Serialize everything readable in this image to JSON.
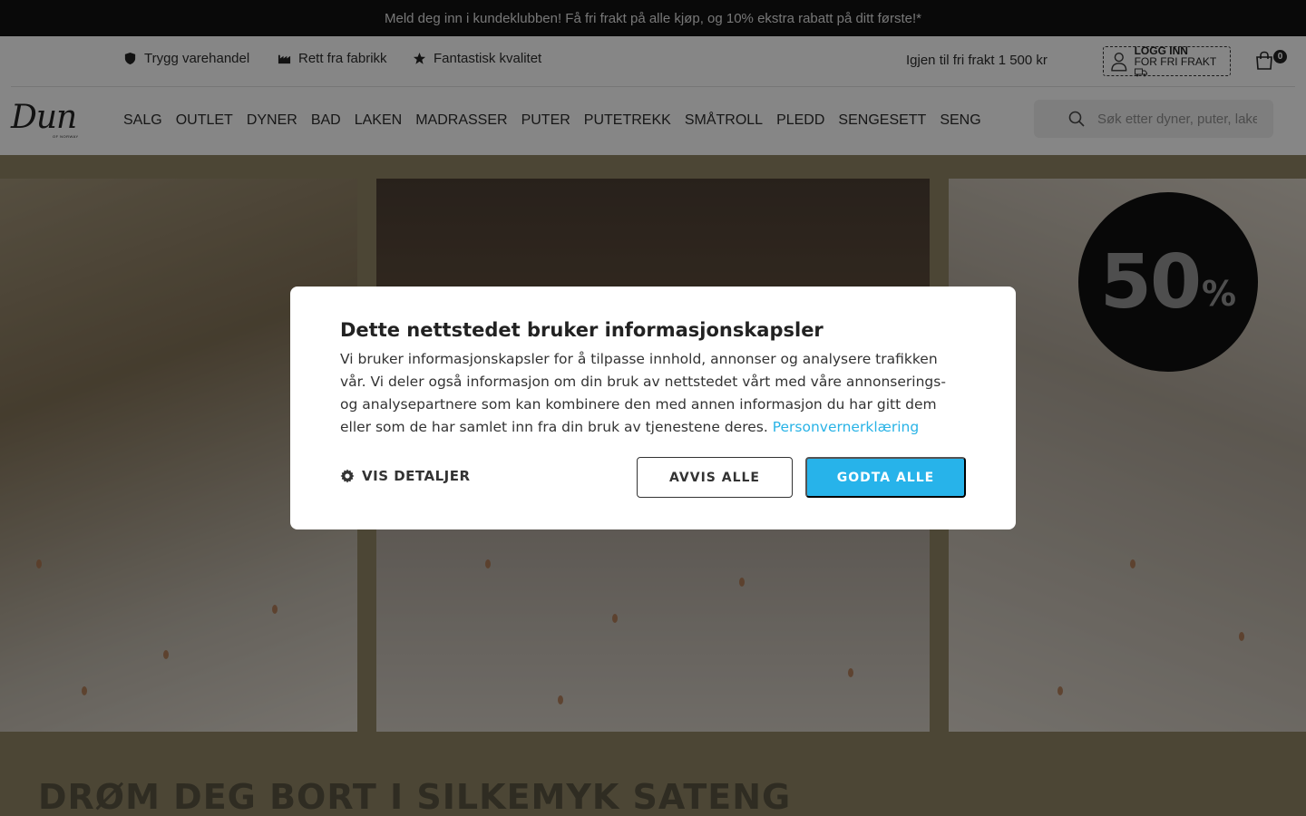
{
  "promo": {
    "text": "Meld deg inn i kundeklubben! Få fri frakt på alle kjøp, og 10% ekstra rabatt på ditt første!*"
  },
  "usps": [
    {
      "label": "Trygg varehandel",
      "icon": "shield-icon"
    },
    {
      "label": "Rett fra fabrikk",
      "icon": "factory-icon"
    },
    {
      "label": "Fantastisk kvalitet",
      "icon": "star-icon"
    }
  ],
  "shipping": {
    "text": "Igjen til fri frakt 1 500 kr"
  },
  "account": {
    "line1": "LOGG INN",
    "line2": "FOR FRI FRAKT"
  },
  "cart": {
    "count": "0"
  },
  "logo": {
    "main": "Dun",
    "sub": "OF NORWAY"
  },
  "nav": [
    "SALG",
    "OUTLET",
    "DYNER",
    "BAD",
    "LAKEN",
    "MADRASSER",
    "PUTER",
    "PUTETREKK",
    "SMÅTROLL",
    "PLEDD",
    "SENGESETT",
    "SENG"
  ],
  "search": {
    "placeholder": "Søk etter dyner, puter, laken"
  },
  "hero": {
    "badge_number": "50",
    "badge_percent": "%",
    "title": "DRØM DEG BORT I SILKEMYK SATENG"
  },
  "cookie_dialog": {
    "title": "Dette nettstedet bruker informasjonskapsler",
    "body": "Vi bruker informasjonskapsler for å tilpasse innhold, annonser og analysere trafikken vår. Vi deler også informasjon om din bruk av nettstedet vårt med våre annonserings- og analysepartnere som kan kombinere den med annen informasjon du har gitt dem eller som de har samlet inn fra din bruk av tjenestene deres.",
    "privacy_link": "Personvernerklæring",
    "details_label": "VIS DETALJER",
    "reject_label": "AVVIS ALLE",
    "accept_label": "GODTA ALLE"
  },
  "colors": {
    "accent": "#27b3ea",
    "link": "#29b3e6",
    "hero_bg": "#8a8062"
  }
}
